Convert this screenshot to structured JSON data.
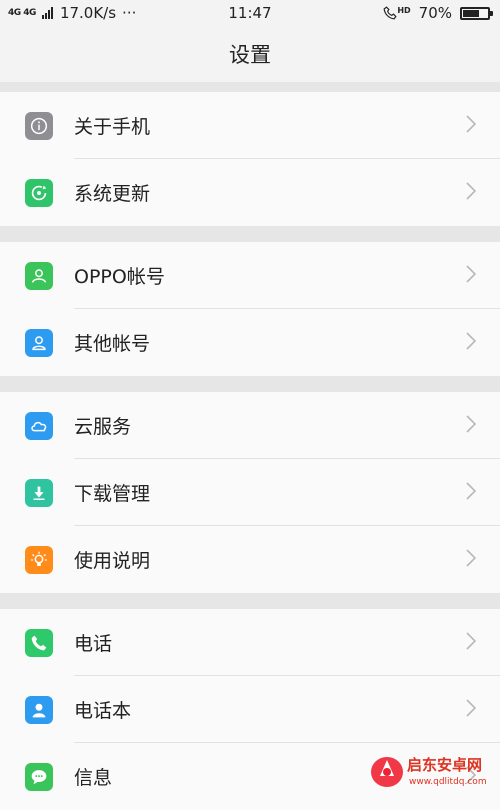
{
  "status_bar": {
    "network": "4G 4G",
    "speed": "17.0K/s",
    "more": "···",
    "time": "11:47",
    "call_hd": "HD",
    "battery_percent": "70%",
    "battery_level": 0.7
  },
  "title": "设置",
  "groups": [
    {
      "items": [
        {
          "label": "关于手机",
          "icon": "info-icon",
          "color": "#8e8e93"
        },
        {
          "label": "系统更新",
          "icon": "system-update-icon",
          "color": "#2fc36a"
        }
      ]
    },
    {
      "items": [
        {
          "label": "OPPO帐号",
          "icon": "person-icon",
          "color": "#3bc45a"
        },
        {
          "label": "其他帐号",
          "icon": "person-outline-icon",
          "color": "#2d9cf0"
        }
      ]
    },
    {
      "items": [
        {
          "label": "云服务",
          "icon": "cloud-icon",
          "color": "#2d9cf0"
        },
        {
          "label": "下载管理",
          "icon": "download-icon",
          "color": "#2fc3a0"
        },
        {
          "label": "使用说明",
          "icon": "lightbulb-icon",
          "color": "#ff8c1a"
        }
      ]
    },
    {
      "items": [
        {
          "label": "电话",
          "icon": "phone-icon",
          "color": "#2fc86a"
        },
        {
          "label": "电话本",
          "icon": "contacts-icon",
          "color": "#2d9cf0"
        },
        {
          "label": "信息",
          "icon": "message-icon",
          "color": "#3bc45a"
        }
      ]
    }
  ],
  "watermark": {
    "brand": "启东安卓网",
    "url": "www.qdlitdq.com"
  }
}
